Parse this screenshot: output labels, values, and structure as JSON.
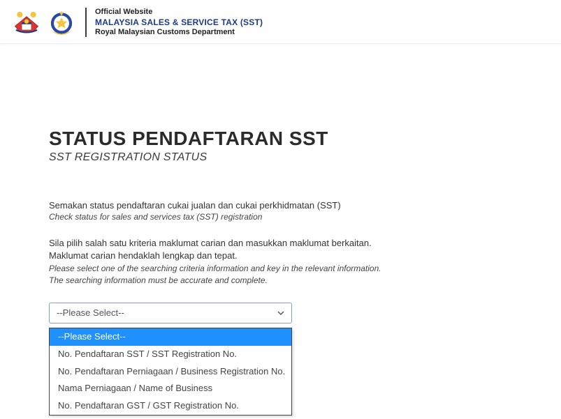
{
  "header": {
    "line1": "Official Website",
    "line2": "MALAYSIA SALES & SERVICE TAX (SST)",
    "line3": "Royal Malaysian Customs Department"
  },
  "page": {
    "title_main": "STATUS PENDAFTARAN SST",
    "title_sub": "SST REGISTRATION STATUS",
    "desc1": "Semakan status pendaftaran cukai jualan dan cukai perkhidmatan (SST)",
    "desc1_i": "Check status for sales and services tax (SST) registration",
    "desc2a": "Sila pilih salah satu kriteria maklumat carian dan masukkan maklumat berkaitan.",
    "desc2b": "Maklumat carian hendaklah lengkap dan tepat.",
    "desc2_ia": "Please select one of the searching criteria information and key in the relevant information.",
    "desc2_ib": "The searching information must be accurate and complete."
  },
  "select": {
    "value": "--Please Select--",
    "options": [
      "--Please Select--",
      "No. Pendaftaran SST / SST Registration No.",
      "No. Pendaftaran Perniagaan / Business Registration No.",
      "Nama Perniagaan / Name of Business",
      "No. Pendaftaran GST / GST Registration No."
    ]
  }
}
